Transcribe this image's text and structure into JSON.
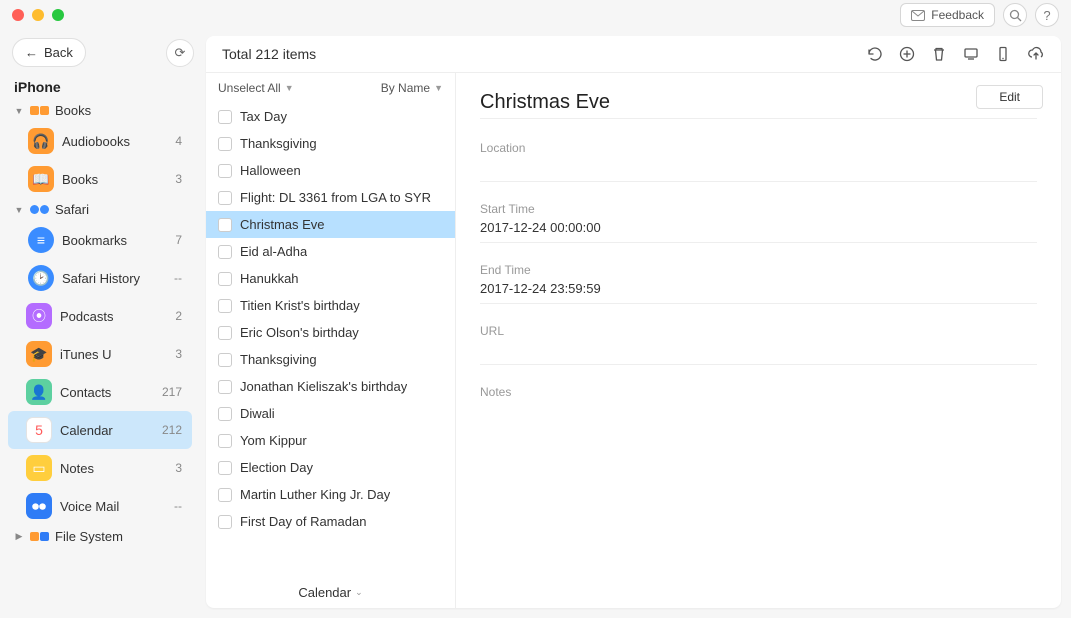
{
  "titlebar": {
    "feedback_label": "Feedback",
    "back_label": "Back"
  },
  "device_label": "iPhone",
  "groups": {
    "books": {
      "label": "Books",
      "expanded": true
    },
    "safari": {
      "label": "Safari",
      "expanded": true
    },
    "filesystem": {
      "label": "File System",
      "expanded": false
    }
  },
  "sidebar": {
    "audiobooks": {
      "label": "Audiobooks",
      "count": "4"
    },
    "books": {
      "label": "Books",
      "count": "3"
    },
    "bookmarks": {
      "label": "Bookmarks",
      "count": "7"
    },
    "safari_history": {
      "label": "Safari History",
      "count": "--"
    },
    "podcasts": {
      "label": "Podcasts",
      "count": "2"
    },
    "itunesu": {
      "label": "iTunes U",
      "count": "3"
    },
    "contacts": {
      "label": "Contacts",
      "count": "217"
    },
    "calendar": {
      "label": "Calendar",
      "count": "212"
    },
    "notes": {
      "label": "Notes",
      "count": "3"
    },
    "voicemail": {
      "label": "Voice Mail",
      "count": "--"
    }
  },
  "main": {
    "header_total": "Total 212 items",
    "unselect_label": "Unselect All",
    "sort_label": "By Name",
    "footer_label": "Calendar"
  },
  "events": [
    "Tax Day",
    "Thanksgiving",
    "Halloween",
    "Flight: DL 3361 from LGA to SYR",
    "Christmas Eve",
    "Eid al-Adha",
    "Hanukkah",
    "Titien Krist's birthday",
    "Eric Olson's birthday",
    "Thanksgiving",
    "Jonathan Kieliszak's birthday",
    "Diwali",
    "Yom Kippur",
    "Election Day",
    "Martin Luther King Jr. Day",
    "First Day of Ramadan"
  ],
  "selected_event_index": 4,
  "detail": {
    "title": "Christmas Eve",
    "edit_label": "Edit",
    "location_label": "Location",
    "location_value": "",
    "start_label": "Start Time",
    "start_value": "2017-12-24 00:00:00",
    "end_label": "End Time",
    "end_value": "2017-12-24 23:59:59",
    "url_label": "URL",
    "url_value": "",
    "notes_label": "Notes",
    "notes_value": ""
  }
}
